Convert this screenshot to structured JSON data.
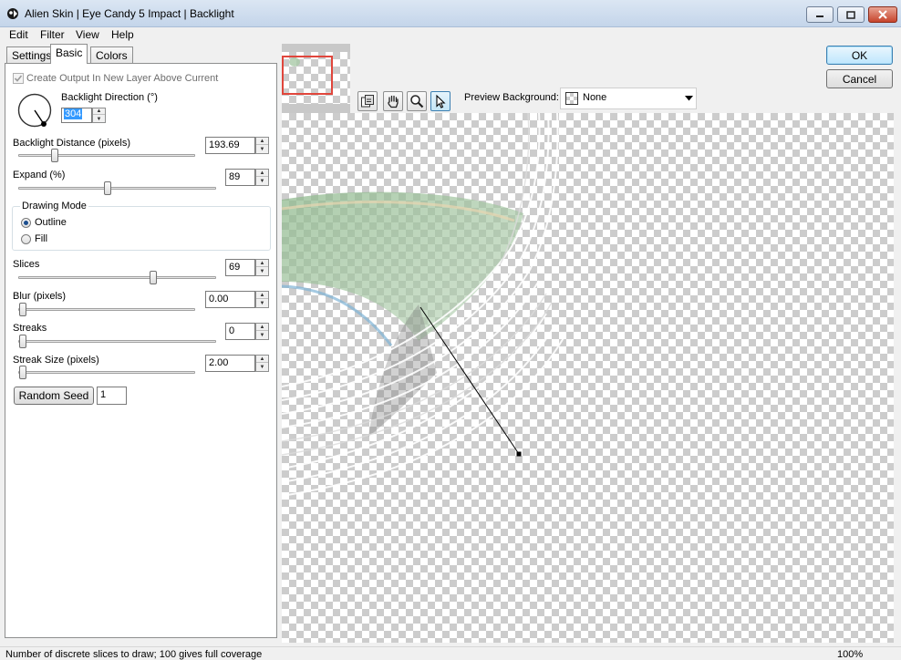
{
  "window": {
    "title": "Alien Skin | Eye Candy 5 Impact | Backlight"
  },
  "menu": [
    "Edit",
    "Filter",
    "View",
    "Help"
  ],
  "tabs": [
    "Settings",
    "Basic",
    "Colors"
  ],
  "basic": {
    "create_output_label": "Create Output In New Layer Above Current",
    "create_output_checked": true,
    "direction_label": "Backlight Direction (°)",
    "direction_value": "304",
    "distance_label": "Backlight Distance (pixels)",
    "distance_value": "193.69",
    "expand_label": "Expand (%)",
    "expand_value": "89",
    "drawing_mode_label": "Drawing Mode",
    "outline_label": "Outline",
    "fill_label": "Fill",
    "drawing_mode_selected": "Outline",
    "slices_label": "Slices",
    "slices_value": "69",
    "blur_label": "Blur (pixels)",
    "blur_value": "0.00",
    "streaks_label": "Streaks",
    "streaks_value": "0",
    "streak_size_label": "Streak Size (pixels)",
    "streak_size_value": "2.00",
    "random_seed_label": "Random Seed",
    "random_seed_value": "1"
  },
  "buttons": {
    "ok": "OK",
    "cancel": "Cancel"
  },
  "preview": {
    "background_label": "Preview Background:",
    "background_value": "None"
  },
  "status": {
    "hint": "Number of discrete slices to draw; 100 gives full coverage",
    "zoom": "100%"
  },
  "colors": {
    "accent": "#3c7fb1",
    "titlebar": "#c4d5ea",
    "thumb_frame": "#e0463c"
  }
}
